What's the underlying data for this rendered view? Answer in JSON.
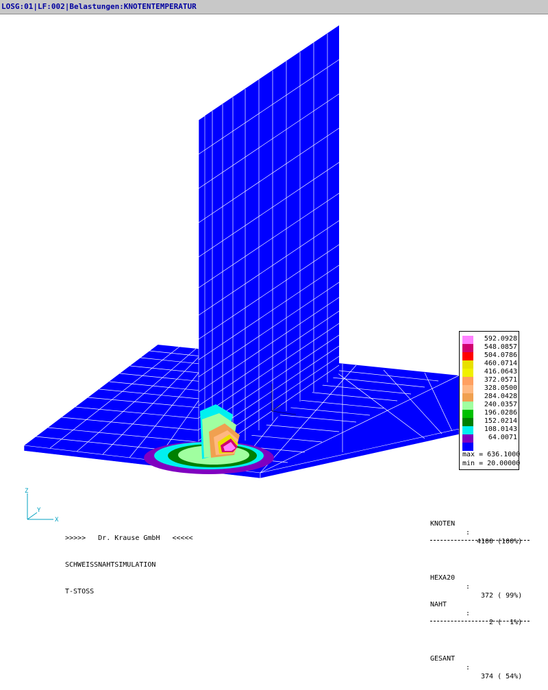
{
  "window": {
    "title": "LOSG:01|LF:002|Belastungen:KNOTENTEMPERATUR"
  },
  "legend": {
    "entries": [
      {
        "value": "592.0928",
        "color": "#ff80ff"
      },
      {
        "value": "548.0857",
        "color": "#d00070"
      },
      {
        "value": "504.0786",
        "color": "#ff0000"
      },
      {
        "value": "460.0714",
        "color": "#e8e000"
      },
      {
        "value": "416.0643",
        "color": "#f0f000"
      },
      {
        "value": "372.0571",
        "color": "#ffa060"
      },
      {
        "value": "328.0500",
        "color": "#ffb880"
      },
      {
        "value": "284.0428",
        "color": "#f0a050"
      },
      {
        "value": "240.0357",
        "color": "#a0ffa0"
      },
      {
        "value": "196.0286",
        "color": "#00c000"
      },
      {
        "value": "152.0214",
        "color": "#008000"
      },
      {
        "value": "108.0143",
        "color": "#00f0f0"
      },
      {
        "value": "64.0071",
        "color": "#8000c0"
      },
      {
        "value": "",
        "color": "#0000ff"
      }
    ],
    "max": "max = 636.1000",
    "min": "min = 20.00000"
  },
  "footer": {
    "company": ">>>>>   Dr. Krause GmbH   <<<<<",
    "line2": "SCHWEISSNAHTSIMULATION",
    "line3": "T-STOSS"
  },
  "stats": {
    "rows": [
      {
        "label": "KNOTEN",
        "value": "4100 (100%)"
      },
      {
        "label": "HEXA20",
        "value": " 372 ( 99%)"
      },
      {
        "label": "NAHT",
        "value": "   2 (  1%)"
      },
      {
        "label": "GESANT",
        "value": " 374 ( 54%)"
      }
    ]
  },
  "axes": {
    "z": "Z",
    "y": "Y",
    "x": "X"
  },
  "colors": {
    "mesh_blue": "#0000ff",
    "grid_line": "#ffffff",
    "axis": "#00a0c0"
  }
}
